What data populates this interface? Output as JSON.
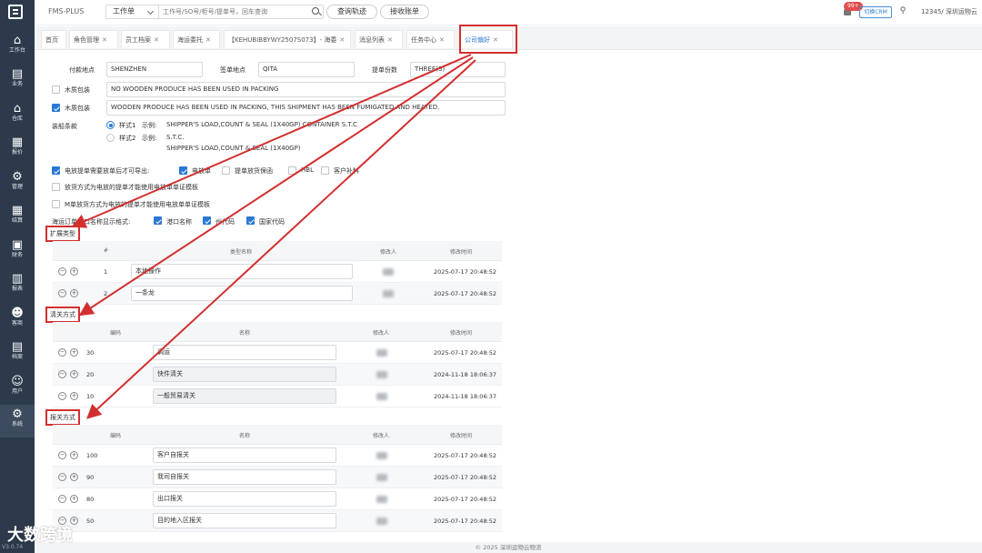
{
  "app": {
    "brand": "FMS-PLUS",
    "version": "V3.0.74",
    "footer": "© 2025 深圳运物云物流",
    "watermark": "大数跨境"
  },
  "sidebar": {
    "items": [
      {
        "label": "工作台",
        "icon": "home-icon",
        "glyph": "⌂"
      },
      {
        "label": "业务",
        "icon": "document-icon",
        "glyph": "▤"
      },
      {
        "label": "仓库",
        "icon": "warehouse-icon",
        "glyph": "⌂"
      },
      {
        "label": "报价",
        "icon": "quote-icon",
        "glyph": "▦"
      },
      {
        "label": "管理",
        "icon": "manage-icon",
        "glyph": "⚙"
      },
      {
        "label": "结算",
        "icon": "calculator-icon",
        "glyph": "▦"
      },
      {
        "label": "财务",
        "icon": "finance-icon",
        "glyph": "▣"
      },
      {
        "label": "报表",
        "icon": "report-icon",
        "glyph": "▥"
      },
      {
        "label": "客商",
        "icon": "customers-icon",
        "glyph": "☻"
      },
      {
        "label": "档案",
        "icon": "archive-icon",
        "glyph": "▤"
      },
      {
        "label": "用户",
        "icon": "user-icon",
        "glyph": "☺"
      },
      {
        "label": "系统",
        "icon": "gear-icon",
        "glyph": "⚙"
      }
    ]
  },
  "topbar": {
    "order_type": "工作单",
    "search_placeholder": "工作号/SO号/柜号/提单号，回车查询",
    "track_button": "查询轨迹",
    "accept_button": "接收账单",
    "badge": "99+",
    "crm_button": "切换CRM",
    "user": "12345/ 深圳运物云"
  },
  "tabs": [
    {
      "label": "首页",
      "closable": false
    },
    {
      "label": "角色管理",
      "closable": true
    },
    {
      "label": "员工档案",
      "closable": true
    },
    {
      "label": "海运委托",
      "closable": true
    },
    {
      "label": "【KEHUBIBBYWY2507S073】- 海委",
      "closable": true
    },
    {
      "label": "消息列表",
      "closable": true
    },
    {
      "label": "任务中心",
      "closable": true
    },
    {
      "label": "公司偏好",
      "closable": true,
      "active": true
    }
  ],
  "form": {
    "pay_place_label": "付款地点",
    "pay_place": "SHENZHEN",
    "sign_place_label": "签单地点",
    "sign_place": "QITA",
    "bl_copies_label": "提单份数",
    "bl_copies": "THREE(3)",
    "wood1": {
      "label": "木质包装",
      "checked": false,
      "text": "NO WOODEN PRODUCE HAS BEEN USED IN PACKING"
    },
    "wood2": {
      "label": "木质包装",
      "checked": true,
      "text": "WOODEN PRODUCE HAS BEEN USED IN PACKING, THIS SHIPMENT HAS BEEN FUMIGATED AND HEATED."
    },
    "clause_label": "装船条款",
    "style1": {
      "label": "样式1",
      "example_label": "示例:",
      "line1": "SHIPPER'S LOAD,COUNT & SEAL (1X40GP) CONTAINER S.T.C",
      "checked": true
    },
    "style2": {
      "label": "样式2",
      "example_label": "示例:",
      "line1": "S.T.C.",
      "line2": "SHIPPER'S LOAD,COUNT & SEAL (1X40GP)",
      "checked": false
    },
    "release_label": "电放提单需要放单后才可导出:",
    "release_opts": [
      {
        "label": "电放单",
        "checked": true
      },
      {
        "label": "提单放货保函",
        "checked": false
      },
      {
        "label": "HBL",
        "checked": false
      },
      {
        "label": "客户补料",
        "checked": false
      }
    ],
    "opt_release_template": {
      "label": "放货方式为电放的提单才能使用电放单单证模板",
      "checked": false
    },
    "opt_mbl_template": {
      "label": "M单放货方式为电放的提单才能使用电放单单证模板",
      "checked": false
    },
    "port_format_label": "海运订单港口名称显示格式:",
    "port_opts": [
      {
        "label": "港口名称",
        "checked": true
      },
      {
        "label": "州代码",
        "checked": true
      },
      {
        "label": "国家代码",
        "checked": true
      }
    ]
  },
  "ext_type": {
    "title": "扩展类型",
    "headers": {
      "num": "#",
      "name": "类型名称",
      "modifier": "修改人",
      "time": "修改时间"
    },
    "rows": [
      {
        "num": "1",
        "name": "本地操作",
        "time": "2025-07-17 20:48:52"
      },
      {
        "num": "2",
        "name": "一条龙",
        "time": "2025-07-17 20:48:52"
      }
    ]
  },
  "clearance": {
    "title": "清关方式",
    "headers": {
      "code": "编码",
      "name": "名称",
      "modifier": "修改人",
      "time": "修改时间"
    },
    "rows": [
      {
        "code": "30",
        "name": "调运",
        "time": "2025-07-17 20:48:52"
      },
      {
        "code": "20",
        "name": "快件清关",
        "time": "2024-11-18 18:06:37"
      },
      {
        "code": "10",
        "name": "一般贸易清关",
        "time": "2024-11-18 18:06:37"
      }
    ]
  },
  "declaration": {
    "title": "报关方式",
    "headers": {
      "code": "编码",
      "name": "名称",
      "modifier": "修改人",
      "time": "修改时间"
    },
    "rows": [
      {
        "code": "100",
        "name": "客户自报关",
        "time": "2025-07-17 20:48:52"
      },
      {
        "code": "90",
        "name": "我司自报关",
        "time": "2025-07-17 20:48:52"
      },
      {
        "code": "80",
        "name": "出口报关",
        "time": "2025-07-17 20:48:52"
      },
      {
        "code": "50",
        "name": "目的地入区报关",
        "time": "2025-07-17 20:48:52"
      }
    ]
  },
  "colors": {
    "sidebar_bg": "#2d3a4b",
    "accent": "#2b78d4",
    "highlight": "#d32f2f"
  }
}
